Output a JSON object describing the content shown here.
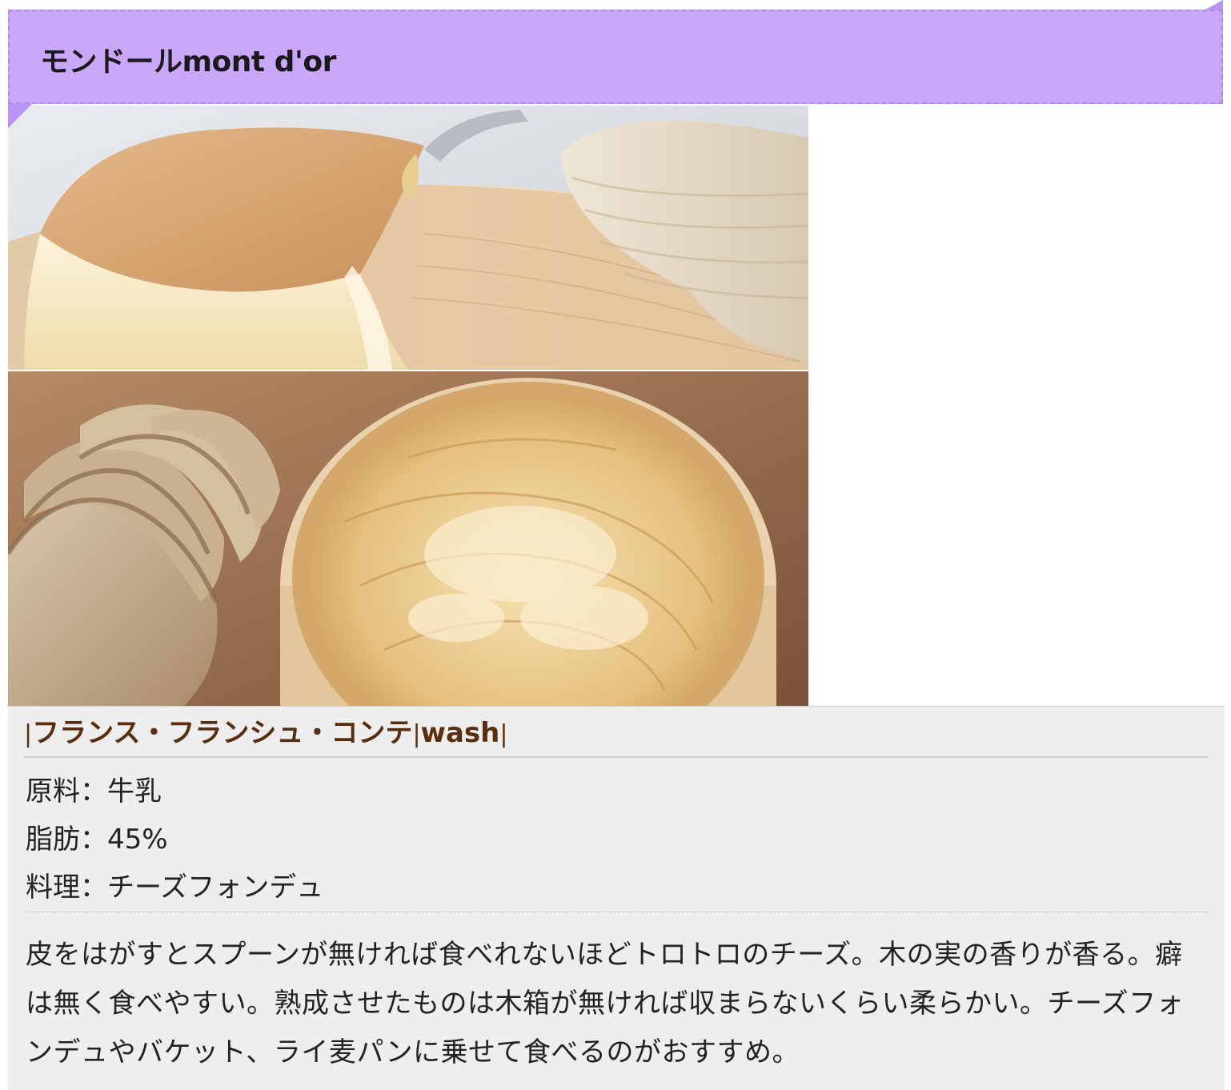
{
  "header": {
    "title": "モンドールmont d'or"
  },
  "photo": {
    "alt": "mont d'or cheese photo",
    "icon": "cheese-photo"
  },
  "info": {
    "origin": {
      "separator": "|",
      "country_region": "フランス・フランシュ・コンテ",
      "type": "wash"
    },
    "specs": [
      {
        "label": "原料",
        "value": "牛乳"
      },
      {
        "label": "脂肪",
        "value": "45%"
      },
      {
        "label": "料理",
        "value": "チーズフォンデュ"
      }
    ],
    "spec_lines": [
      "原料：牛乳",
      "脂肪：45%",
      "料理：チーズフォンデュ"
    ],
    "description": "皮をはがすとスプーンが無ければ食べれないほどトロトロのチーズ。木の実の香りが香る。癖は無く食べやすい。熟成させたものは木箱が無ければ収まらないくらい柔らかい。チーズフォンデュやバケット、ライ麦パンに乗せて食べるのがおすすめ。"
  },
  "colors": {
    "ribbon": "#c9a8fb",
    "ribbon_border": "#a98ae8",
    "panel": "#eeeeee",
    "origin_text": "#5a2e0c",
    "body_text": "#222222"
  }
}
